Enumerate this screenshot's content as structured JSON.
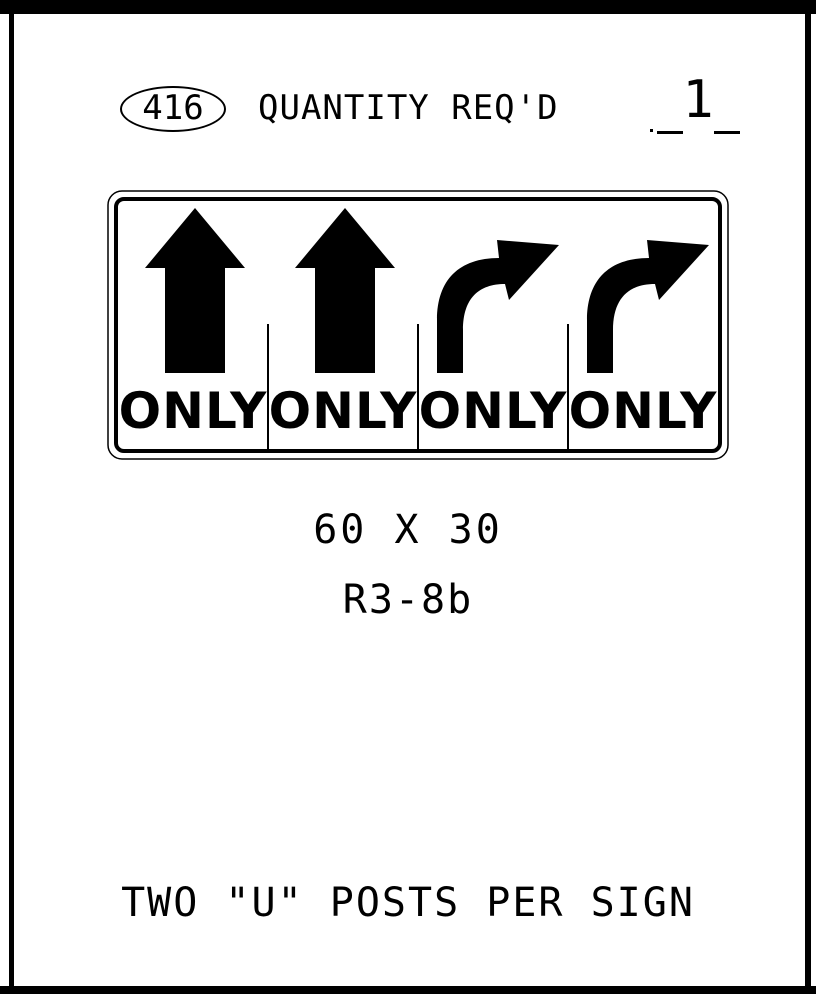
{
  "sheet_number": "416",
  "quantity_label": "QUANTITY REQ'D",
  "quantity_value": "1",
  "sign": {
    "lanes": [
      {
        "arrow": "arrow-up-icon",
        "legend": "ONLY"
      },
      {
        "arrow": "arrow-up-icon",
        "legend": "ONLY"
      },
      {
        "arrow": "arrow-turn-right-icon",
        "legend": "ONLY"
      },
      {
        "arrow": "arrow-turn-right-icon",
        "legend": "ONLY"
      }
    ],
    "colors": {
      "background": "#ffffff",
      "legend": "#000000"
    }
  },
  "size": "60 X 30",
  "sign_code": "R3-8b",
  "posts_note": "TWO \"U\" POSTS PER SIGN"
}
